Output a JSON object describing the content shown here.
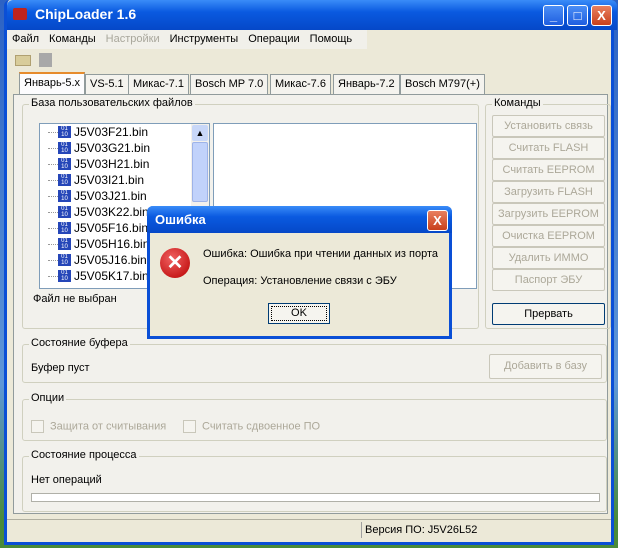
{
  "window": {
    "title": "ChipLoader 1.6",
    "minimize": "_",
    "maximize": "□",
    "close": "X"
  },
  "menu": [
    "Файл",
    "Команды",
    "Настройки",
    "Инструменты",
    "Операции",
    "Помощь"
  ],
  "tabs": [
    "Январь-5.x",
    "VS-5.1",
    "Микас-7.1",
    "Bosch MP 7.0",
    "Микас-7.6",
    "Январь-7.2",
    "Bosch M797(+)"
  ],
  "files_group": {
    "title": "База пользовательских файлов",
    "files": [
      "J5V03F21.bin",
      "J5V03G21.bin",
      "J5V03H21.bin",
      "J5V03I21.bin",
      "J5V03J21.bin",
      "J5V03K22.bin",
      "J5V05F16.bin",
      "J5V05H16.bin",
      "J5V05J16.bin",
      "J5V05K17.bin"
    ],
    "status": "Файл не выбран"
  },
  "commands": {
    "title": "Команды",
    "buttons": [
      "Установить связь",
      "Считать FLASH",
      "Считать EEPROM",
      "Загрузить FLASH",
      "Загрузить EEPROM",
      "Очистка EEPROM",
      "Удалить ИММО",
      "Паспорт ЭБУ"
    ],
    "abort": "Прервать"
  },
  "buffer": {
    "title": "Состояние буфера",
    "status": "Буфер пуст",
    "add": "Добавить в базу"
  },
  "options": {
    "title": "Опции",
    "read_protect": "Защита от считывания",
    "read_double": "Считать сдвоенное ПО"
  },
  "process": {
    "title": "Состояние процесса",
    "status": "Нет операций",
    "progress": 0
  },
  "statusbar": {
    "version": "Версия ПО: J5V26L52"
  },
  "dialog": {
    "title": "Ошибка",
    "close": "X",
    "error": "Ошибка: Ошибка при чтении данных из порта",
    "operation": "Операция: Установление связи с ЭБУ",
    "ok": "OK"
  }
}
